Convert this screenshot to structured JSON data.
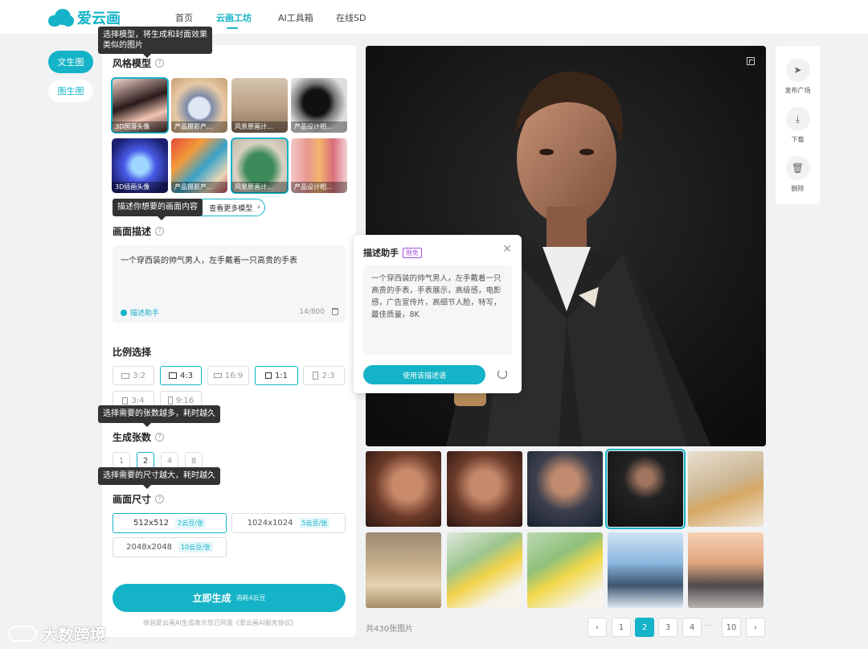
{
  "header": {
    "logo_text": "爱云画",
    "nav": [
      "首页",
      "云画工坊",
      "AI工具箱",
      "在线SD"
    ],
    "nav_active": "云画工坊"
  },
  "side_tabs": [
    "文生图",
    "图生图"
  ],
  "style_model": {
    "title": "风格模型",
    "tooltip": "选择模型，将生成和封面效果\n类似的图片",
    "thumbs": [
      {
        "label": "3D国漫头像",
        "icon": "anime-girl-portrait"
      },
      {
        "label": "产品摄影产...",
        "icon": "porcelain-vase"
      },
      {
        "label": "风景原画计...",
        "icon": "landscape-pavilion"
      },
      {
        "label": "产品设计相...",
        "icon": "black-product"
      },
      {
        "label": "3D插画头像",
        "icon": "blue-3d-icon"
      },
      {
        "label": "产品摄影产...",
        "icon": "colorful-studio"
      },
      {
        "label": "风景原画计...",
        "icon": "green-dress"
      },
      {
        "label": "产品设计相...",
        "icon": "cosmetics-bottles"
      }
    ],
    "more_label": "查看更多模型",
    "more_tooltip": "描述你想要的画面内容"
  },
  "description": {
    "title": "画面描述",
    "text": "一个穿西装的帅气男人，左手戴着一只高贵的手表",
    "helper": "描述助手",
    "count": "14/800"
  },
  "ratio": {
    "title": "比例选择",
    "options": [
      "3:2",
      "4:3",
      "16:9",
      "1:1",
      "2:3",
      "3:4",
      "9:16"
    ],
    "selected": [
      "4:3",
      "1:1"
    ]
  },
  "quantity": {
    "title": "生成张数",
    "tooltip": "选择需要的张数越多，耗时越久",
    "options": [
      "1",
      "2",
      "4",
      "8"
    ],
    "selected": "2"
  },
  "size": {
    "title": "画面尺寸",
    "tooltip": "选择需要的尺寸越大，耗时越久",
    "options": [
      {
        "label": "512x512",
        "cost": "2云豆/张"
      },
      {
        "label": "1024x1024",
        "cost": "5云豆/张"
      },
      {
        "label": "2048x2048",
        "cost": "10云豆/张"
      }
    ],
    "selected": "512x512"
  },
  "generate": {
    "label": "立即生成",
    "cost": "消耗4云豆",
    "agreement": "体验爱云画AI生成表示您已同意《爱云画AI服务协议》"
  },
  "assistant": {
    "title": "描述助手",
    "badge": "限免",
    "text": "一个穿西装的帅气男人，左手戴着一只高贵的手表，手表展示，高级感，电影感，广告宣传片，高细节人脸，特写，最佳质量，8K",
    "use_label": "使用该描述语"
  },
  "actions": [
    {
      "label": "发布广场",
      "icon": "send-icon"
    },
    {
      "label": "下载",
      "icon": "download-icon"
    },
    {
      "label": "删除",
      "icon": "trash-icon"
    }
  ],
  "gallery": {
    "total": "共430张图片",
    "pages": [
      "1",
      "2",
      "3",
      "4",
      "10"
    ],
    "current_page": "2",
    "dots": "···"
  },
  "watermark": "大数跨境"
}
